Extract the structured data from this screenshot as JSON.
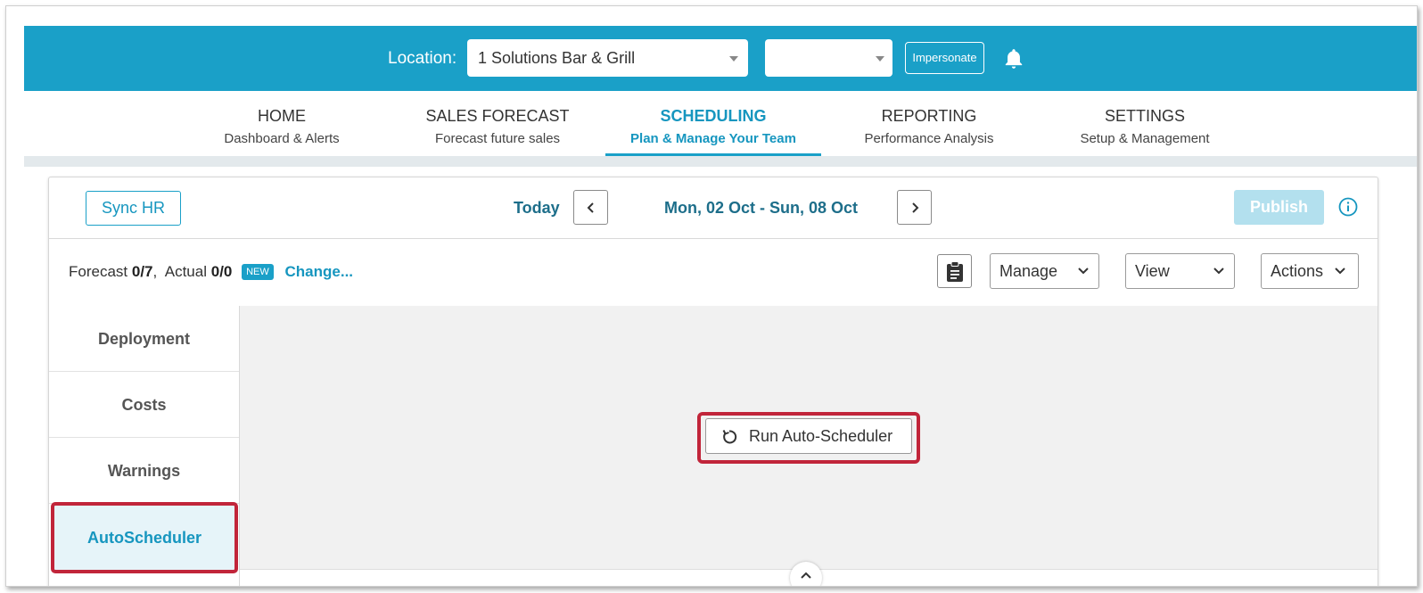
{
  "header": {
    "location_label": "Location:",
    "location_value": "1 Solutions Bar & Grill",
    "second_select_value": "",
    "impersonate_label": "Impersonate",
    "bell_icon": "bell-icon",
    "brand_color": "#1aa0c8"
  },
  "nav": {
    "items": [
      {
        "title": "HOME",
        "subtitle": "Dashboard & Alerts"
      },
      {
        "title": "SALES FORECAST",
        "subtitle": "Forecast future sales"
      },
      {
        "title": "SCHEDULING",
        "subtitle": "Plan & Manage Your Team"
      },
      {
        "title": "REPORTING",
        "subtitle": "Performance Analysis"
      },
      {
        "title": "SETTINGS",
        "subtitle": "Setup & Management"
      }
    ],
    "active_index": 2
  },
  "toolbar": {
    "sync_hr_label": "Sync HR",
    "today_label": "Today",
    "date_range": "Mon, 02 Oct - Sun, 08 Oct",
    "publish_label": "Publish"
  },
  "forecast": {
    "forecast_label": "Forecast",
    "forecast_value": "0/7",
    "actual_label": "Actual",
    "actual_value": "0/0",
    "new_badge": "NEW",
    "change_link": "Change..."
  },
  "dropdowns": {
    "manage": "Manage",
    "view": "View",
    "actions": "Actions"
  },
  "sidebar": {
    "items": [
      {
        "label": "Deployment"
      },
      {
        "label": "Costs"
      },
      {
        "label": "Warnings"
      },
      {
        "label": "AutoScheduler"
      }
    ],
    "active_index": 3
  },
  "main": {
    "run_autoscheduler_label": "Run Auto-Scheduler"
  },
  "colors": {
    "highlight": "#c1253a",
    "accent_text": "#1696bf"
  }
}
